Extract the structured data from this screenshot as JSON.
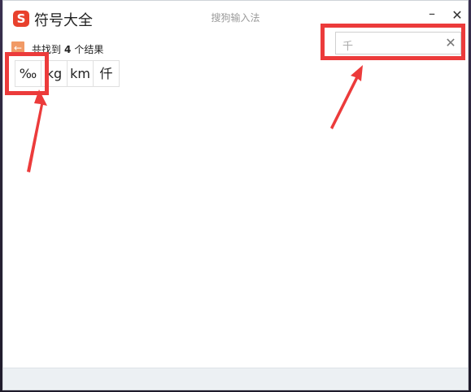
{
  "window": {
    "logo_glyph": "S",
    "title": "符号大全",
    "ime_name": "搜狗输入法",
    "minimize_glyph": "–",
    "close_glyph": "✕"
  },
  "results": {
    "back_glyph": "←",
    "prefix": "共找到",
    "count": "4",
    "suffix": "个结果"
  },
  "symbols": [
    "‰",
    "kg",
    "km",
    "仟"
  ],
  "search": {
    "query": "千",
    "clear_glyph": "✕"
  },
  "annotation_color": "#ec3b3b"
}
